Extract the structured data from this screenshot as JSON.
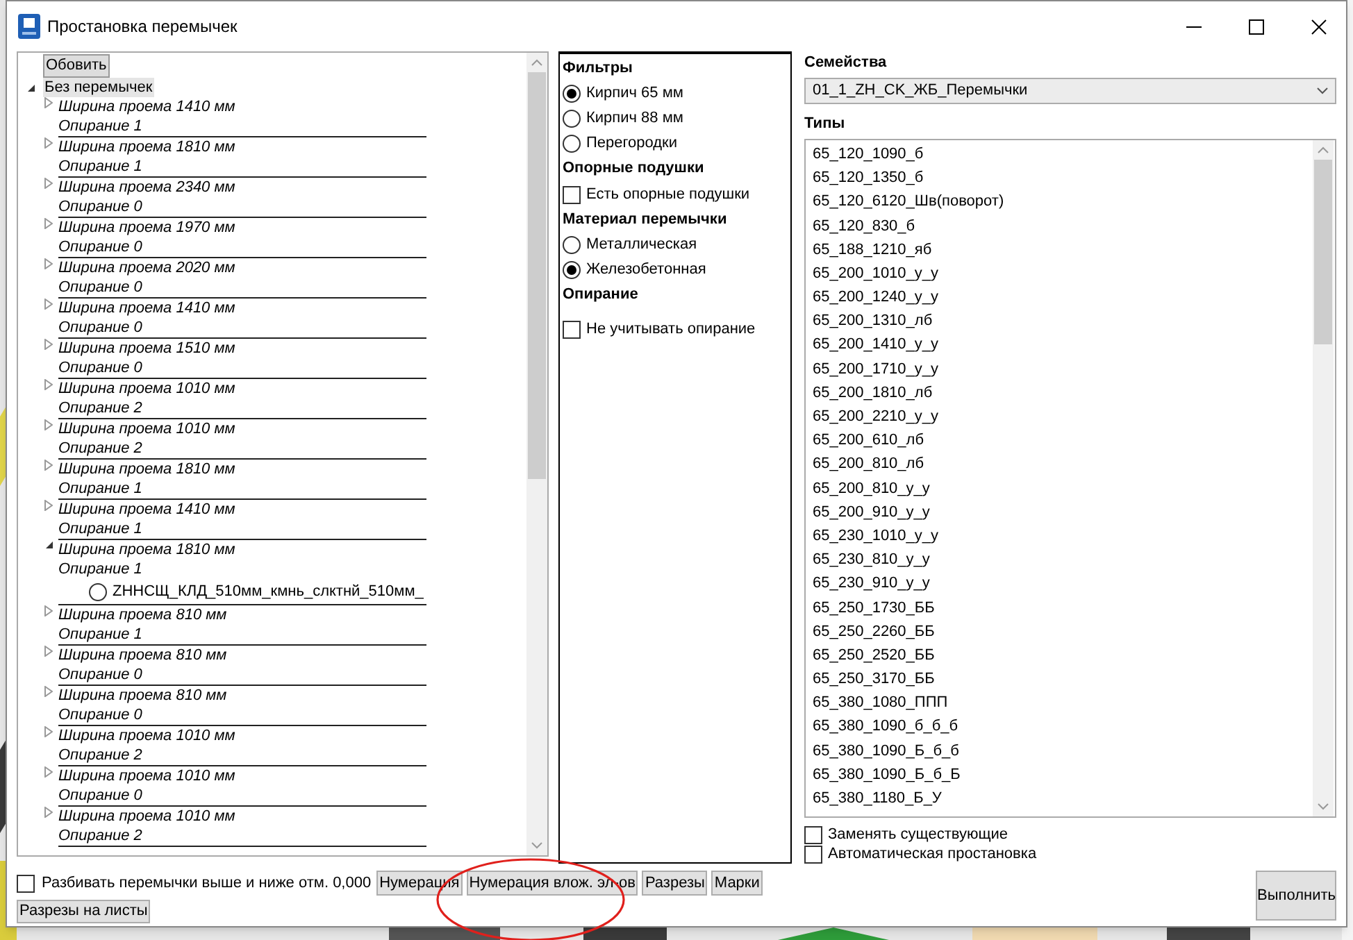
{
  "window": {
    "title": "Простановка перемычек"
  },
  "tree": {
    "refresh_button": "Обовить",
    "root": {
      "label": "Без перемычек",
      "expanded": true,
      "selected": true,
      "children": [
        {
          "width": "Ширина проема 1410 мм",
          "support": "Опирание 1",
          "expanded": false
        },
        {
          "width": "Ширина проема 1810 мм",
          "support": "Опирание 1",
          "expanded": false
        },
        {
          "width": "Ширина проема 2340 мм",
          "support": "Опирание 0",
          "expanded": false
        },
        {
          "width": "Ширина проема 1970 мм",
          "support": "Опирание 0",
          "expanded": false
        },
        {
          "width": "Ширина проема 2020 мм",
          "support": "Опирание 0",
          "expanded": false
        },
        {
          "width": "Ширина проема 1410 мм",
          "support": "Опирание 0",
          "expanded": false
        },
        {
          "width": "Ширина проема 1510 мм",
          "support": "Опирание 0",
          "expanded": false
        },
        {
          "width": "Ширина проема 1010 мм",
          "support": "Опирание 2",
          "expanded": false
        },
        {
          "width": "Ширина проема 1010 мм",
          "support": "Опирание 2",
          "expanded": false
        },
        {
          "width": "Ширина проема 1810 мм",
          "support": "Опирание 1",
          "expanded": false
        },
        {
          "width": "Ширина проема 1410 мм",
          "support": "Опирание 1",
          "expanded": false
        },
        {
          "width": "Ширина проема 1810 мм",
          "support": "Опирание 1",
          "expanded": true,
          "children": [
            {
              "label": "ZHНСЩ_КЛД_510мм_кмнь_слктнй_510мм_",
              "selected": false
            }
          ]
        },
        {
          "width": "Ширина проема 810 мм",
          "support": "Опирание 1",
          "expanded": false
        },
        {
          "width": "Ширина проема 810 мм",
          "support": "Опирание 0",
          "expanded": false
        },
        {
          "width": "Ширина проема 810 мм",
          "support": "Опирание 0",
          "expanded": false
        },
        {
          "width": "Ширина проема 1010 мм",
          "support": "Опирание 2",
          "expanded": false
        },
        {
          "width": "Ширина проема 1010 мм",
          "support": "Опирание 0",
          "expanded": false
        },
        {
          "width": "Ширина проема 1010 мм",
          "support": "Опирание 2",
          "expanded": false
        }
      ]
    }
  },
  "filters": [
    {
      "kind": "heading",
      "label": "Фильтры"
    },
    {
      "kind": "radio",
      "label": "Кирпич 65 мм",
      "selected": true
    },
    {
      "kind": "radio",
      "label": "Кирпич 88 мм",
      "selected": false
    },
    {
      "kind": "radio",
      "label": "Перегородки",
      "selected": false
    },
    {
      "kind": "heading",
      "label": "Опорные подушки"
    },
    {
      "kind": "checkbox",
      "label": "Есть опорные подушки",
      "checked": false
    },
    {
      "kind": "heading",
      "label": "Материал перемычки"
    },
    {
      "kind": "radio",
      "label": "Металлическая",
      "selected": false
    },
    {
      "kind": "radio",
      "label": "Железобетонная",
      "selected": true
    },
    {
      "kind": "heading",
      "label": "Опирание"
    },
    {
      "kind": "checkbox",
      "label": "Не учитывать опирание",
      "checked": false
    }
  ],
  "families": {
    "label": "Семейства",
    "value": "01_1_ZH_CK_ЖБ_Перемычки"
  },
  "types": {
    "label": "Типы",
    "items": [
      "65_120_1090_б",
      "65_120_1350_б",
      "65_120_6120_Шв(поворот)",
      "65_120_830_б",
      "65_188_1210_яб",
      "65_200_1010_у_у",
      "65_200_1240_у_у",
      "65_200_1310_лб",
      "65_200_1410_у_у",
      "65_200_1710_у_у",
      "65_200_1810_лб",
      "65_200_2210_у_у",
      "65_200_610_лб",
      "65_200_810_лб",
      "65_200_810_у_у",
      "65_200_910_у_у",
      "65_230_1010_у_у",
      "65_230_810_у_у",
      "65_230_910_у_у",
      "65_250_1730_ББ",
      "65_250_2260_ББ",
      "65_250_2520_ББ",
      "65_250_3170_ББ",
      "65_380_1080_ППП",
      "65_380_1090_б_б_б",
      "65_380_1090_Б_б_б",
      "65_380_1090_Б_б_Б",
      "65_380_1180_Б_У"
    ]
  },
  "options": [
    {
      "label": "Заменять существующие",
      "checked": false
    },
    {
      "label": "Автоматическая простановка",
      "checked": false
    }
  ],
  "bottom": {
    "split": {
      "label": "Разбивать перемычки выше и ниже отм. 0,000",
      "checked": false
    },
    "buttons": [
      "Нумерация",
      "Нумерация влож. эл-ов",
      "Разрезы",
      "Марки"
    ],
    "sheets_button": "Разрезы на листы",
    "run_button": "Выполнить"
  }
}
